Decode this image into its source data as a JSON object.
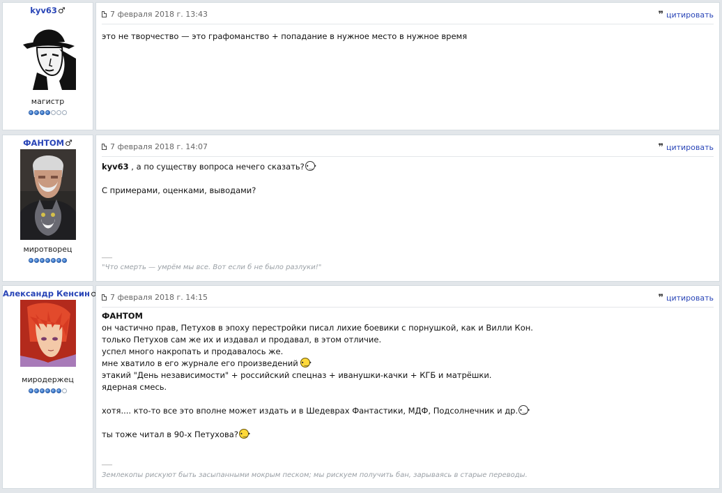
{
  "posts": [
    {
      "username": "kyv63",
      "gender_symbol": "♂",
      "rank": "магистр",
      "rating": 4,
      "date": "7 февраля 2018 г. 13:43",
      "quote_label": "цитировать",
      "lines": [
        "это не творчество — это графоманство + попадание в нужное место в нужное время"
      ]
    },
    {
      "username": "ФАНТОМ",
      "gender_symbol": "♂",
      "rank": "миротворец",
      "rating": 7,
      "date": "7 февраля 2018 г. 14:07",
      "quote_label": "цитировать",
      "addressee": "kyv63",
      "line1": " , а по существу вопроса нечего сказать?",
      "line2": "С примерами, оценками, выводами?",
      "sig_sep": "___",
      "signature": "\"Что смерть — умрём мы все. Вот если б не было разлуки!\""
    },
    {
      "username": "Александр Кенсин",
      "gender_symbol": "♂",
      "rank": "миродержец",
      "rating": 6,
      "date": "7 февраля 2018 г. 14:15",
      "quote_label": "цитировать",
      "addressee": "ФАНТОМ",
      "lines": [
        "он частично прав, Петухов в эпоху перестройки писал лихие боевики с порнушкой, как и Вилли Кон.",
        "только Петухов сам же их и издавал и продавал, в этом отличие.",
        "успел много накропать и продавалось же.",
        "мне хватило в его журнале его произведений",
        "этакий \"День независимости\" + российский спецназ + иванушки-качки + КГБ и матрёшки.",
        "ядерная смесь.",
        "хотя.... кто-то все это вполне может издать и в Шедеврах Фантастики, МДФ, Подсолнечник и др.",
        "ты тоже читал в 90-х Петухова?"
      ],
      "sig_sep": "___",
      "signature": "Землекопы рискуют быть засыпанными мокрым песком; мы рискуем получить бан, зарываясь в старые переводы."
    }
  ]
}
